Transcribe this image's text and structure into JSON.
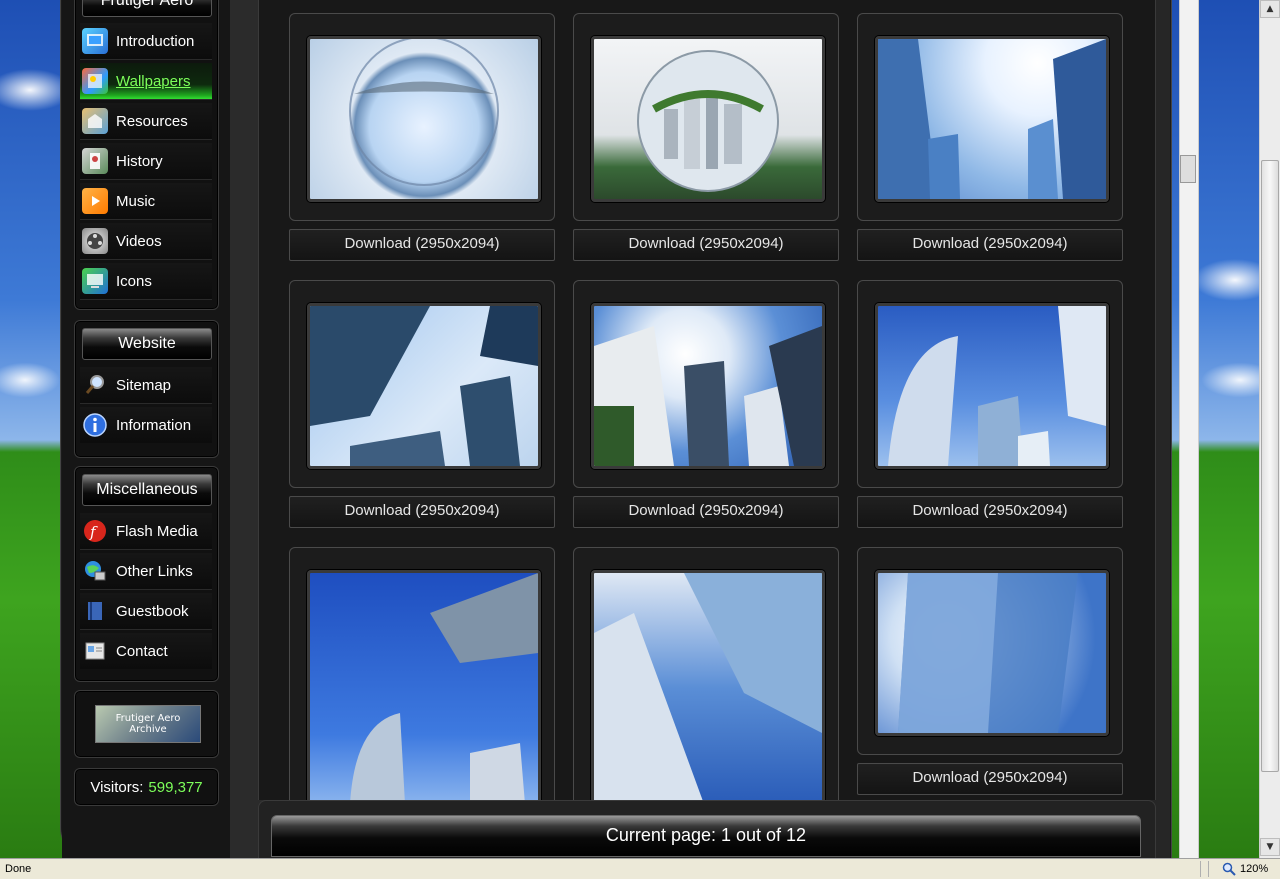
{
  "sidebar": {
    "main_box": {
      "title": "Frutiger Aero",
      "items": [
        {
          "label": "Introduction",
          "icon": "introduction-icon"
        },
        {
          "label": "Wallpapers",
          "icon": "wallpapers-icon"
        },
        {
          "label": "Resources",
          "icon": "resources-icon"
        },
        {
          "label": "History",
          "icon": "history-icon"
        },
        {
          "label": "Music",
          "icon": "music-icon"
        },
        {
          "label": "Videos",
          "icon": "videos-icon"
        },
        {
          "label": "Icons",
          "icon": "icons-icon"
        }
      ]
    },
    "website_box": {
      "title": "Website",
      "items": [
        {
          "label": "Sitemap",
          "icon": "magnifier-icon"
        },
        {
          "label": "Information",
          "icon": "info-icon"
        }
      ]
    },
    "misc_box": {
      "title": "Miscellaneous",
      "items": [
        {
          "label": "Flash Media",
          "icon": "flash-icon"
        },
        {
          "label": "Other Links",
          "icon": "network-icon"
        },
        {
          "label": "Guestbook",
          "icon": "guestbook-icon"
        },
        {
          "label": "Contact",
          "icon": "contact-icon"
        }
      ]
    },
    "logo_text": "Frutiger Aero Archive",
    "visitors": {
      "label": "Visitors:",
      "count": "599,377"
    }
  },
  "gallery": {
    "download_label": "Download (2950x2094)",
    "tiles": [
      {
        "subject": "glass sphere reflecting sky"
      },
      {
        "subject": "glass sphere with city"
      },
      {
        "subject": "skyscrapers and bright sky"
      },
      {
        "subject": "skyscrapers looking up"
      },
      {
        "subject": "towers with clouds"
      },
      {
        "subject": "curved skyscraper"
      },
      {
        "subject": "tower corner blue sky"
      },
      {
        "subject": "glass facade"
      },
      {
        "subject": "tall glass tower clouds"
      }
    ]
  },
  "pager": {
    "text": "Current page: 1 out of 12"
  },
  "statusbar": {
    "status": "Done",
    "zoom": "120%"
  },
  "colors": {
    "accent_green": "#33e033",
    "visitor_count": "#7dff5a"
  }
}
